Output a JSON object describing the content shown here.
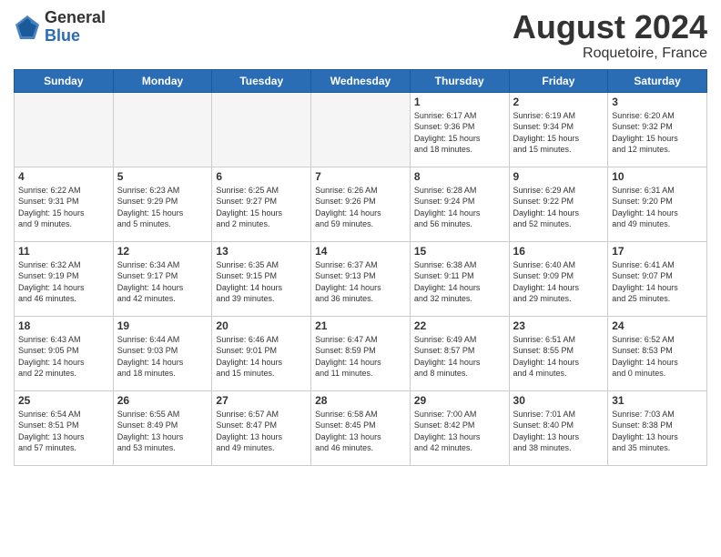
{
  "logo": {
    "general": "General",
    "blue": "Blue"
  },
  "header": {
    "month": "August 2024",
    "location": "Roquetoire, France"
  },
  "weekdays": [
    "Sunday",
    "Monday",
    "Tuesday",
    "Wednesday",
    "Thursday",
    "Friday",
    "Saturday"
  ],
  "weeks": [
    [
      {
        "day": "",
        "info": ""
      },
      {
        "day": "",
        "info": ""
      },
      {
        "day": "",
        "info": ""
      },
      {
        "day": "",
        "info": ""
      },
      {
        "day": "1",
        "info": "Sunrise: 6:17 AM\nSunset: 9:36 PM\nDaylight: 15 hours\nand 18 minutes."
      },
      {
        "day": "2",
        "info": "Sunrise: 6:19 AM\nSunset: 9:34 PM\nDaylight: 15 hours\nand 15 minutes."
      },
      {
        "day": "3",
        "info": "Sunrise: 6:20 AM\nSunset: 9:32 PM\nDaylight: 15 hours\nand 12 minutes."
      }
    ],
    [
      {
        "day": "4",
        "info": "Sunrise: 6:22 AM\nSunset: 9:31 PM\nDaylight: 15 hours\nand 9 minutes."
      },
      {
        "day": "5",
        "info": "Sunrise: 6:23 AM\nSunset: 9:29 PM\nDaylight: 15 hours\nand 5 minutes."
      },
      {
        "day": "6",
        "info": "Sunrise: 6:25 AM\nSunset: 9:27 PM\nDaylight: 15 hours\nand 2 minutes."
      },
      {
        "day": "7",
        "info": "Sunrise: 6:26 AM\nSunset: 9:26 PM\nDaylight: 14 hours\nand 59 minutes."
      },
      {
        "day": "8",
        "info": "Sunrise: 6:28 AM\nSunset: 9:24 PM\nDaylight: 14 hours\nand 56 minutes."
      },
      {
        "day": "9",
        "info": "Sunrise: 6:29 AM\nSunset: 9:22 PM\nDaylight: 14 hours\nand 52 minutes."
      },
      {
        "day": "10",
        "info": "Sunrise: 6:31 AM\nSunset: 9:20 PM\nDaylight: 14 hours\nand 49 minutes."
      }
    ],
    [
      {
        "day": "11",
        "info": "Sunrise: 6:32 AM\nSunset: 9:19 PM\nDaylight: 14 hours\nand 46 minutes."
      },
      {
        "day": "12",
        "info": "Sunrise: 6:34 AM\nSunset: 9:17 PM\nDaylight: 14 hours\nand 42 minutes."
      },
      {
        "day": "13",
        "info": "Sunrise: 6:35 AM\nSunset: 9:15 PM\nDaylight: 14 hours\nand 39 minutes."
      },
      {
        "day": "14",
        "info": "Sunrise: 6:37 AM\nSunset: 9:13 PM\nDaylight: 14 hours\nand 36 minutes."
      },
      {
        "day": "15",
        "info": "Sunrise: 6:38 AM\nSunset: 9:11 PM\nDaylight: 14 hours\nand 32 minutes."
      },
      {
        "day": "16",
        "info": "Sunrise: 6:40 AM\nSunset: 9:09 PM\nDaylight: 14 hours\nand 29 minutes."
      },
      {
        "day": "17",
        "info": "Sunrise: 6:41 AM\nSunset: 9:07 PM\nDaylight: 14 hours\nand 25 minutes."
      }
    ],
    [
      {
        "day": "18",
        "info": "Sunrise: 6:43 AM\nSunset: 9:05 PM\nDaylight: 14 hours\nand 22 minutes."
      },
      {
        "day": "19",
        "info": "Sunrise: 6:44 AM\nSunset: 9:03 PM\nDaylight: 14 hours\nand 18 minutes."
      },
      {
        "day": "20",
        "info": "Sunrise: 6:46 AM\nSunset: 9:01 PM\nDaylight: 14 hours\nand 15 minutes."
      },
      {
        "day": "21",
        "info": "Sunrise: 6:47 AM\nSunset: 8:59 PM\nDaylight: 14 hours\nand 11 minutes."
      },
      {
        "day": "22",
        "info": "Sunrise: 6:49 AM\nSunset: 8:57 PM\nDaylight: 14 hours\nand 8 minutes."
      },
      {
        "day": "23",
        "info": "Sunrise: 6:51 AM\nSunset: 8:55 PM\nDaylight: 14 hours\nand 4 minutes."
      },
      {
        "day": "24",
        "info": "Sunrise: 6:52 AM\nSunset: 8:53 PM\nDaylight: 14 hours\nand 0 minutes."
      }
    ],
    [
      {
        "day": "25",
        "info": "Sunrise: 6:54 AM\nSunset: 8:51 PM\nDaylight: 13 hours\nand 57 minutes."
      },
      {
        "day": "26",
        "info": "Sunrise: 6:55 AM\nSunset: 8:49 PM\nDaylight: 13 hours\nand 53 minutes."
      },
      {
        "day": "27",
        "info": "Sunrise: 6:57 AM\nSunset: 8:47 PM\nDaylight: 13 hours\nand 49 minutes."
      },
      {
        "day": "28",
        "info": "Sunrise: 6:58 AM\nSunset: 8:45 PM\nDaylight: 13 hours\nand 46 minutes."
      },
      {
        "day": "29",
        "info": "Sunrise: 7:00 AM\nSunset: 8:42 PM\nDaylight: 13 hours\nand 42 minutes."
      },
      {
        "day": "30",
        "info": "Sunrise: 7:01 AM\nSunset: 8:40 PM\nDaylight: 13 hours\nand 38 minutes."
      },
      {
        "day": "31",
        "info": "Sunrise: 7:03 AM\nSunset: 8:38 PM\nDaylight: 13 hours\nand 35 minutes."
      }
    ]
  ]
}
